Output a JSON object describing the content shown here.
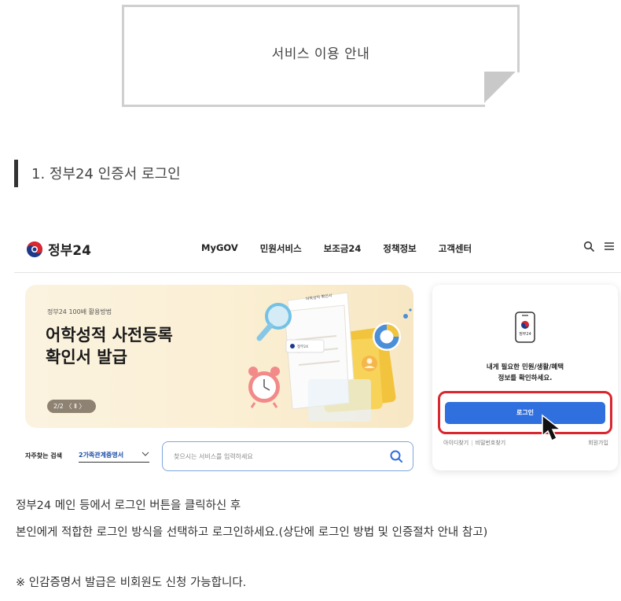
{
  "notice": {
    "title": "서비스 이용 안내"
  },
  "section": {
    "title": "1. 정부24 인증서 로그인"
  },
  "gov24": {
    "logo_text": "정부24",
    "nav": [
      "MyGOV",
      "민원서비스",
      "보조금24",
      "정책정보",
      "고객센터"
    ],
    "icons": {
      "search": "search-icon",
      "menu": "hamburger-menu-icon"
    },
    "banner": {
      "sub": "정부24 100배 활용방법",
      "title_line1": "어학성적 사전등록",
      "title_line2": "확인서 발급",
      "pager": "2/2 〈 Ⅱ 〉",
      "doc_label": "어학성적 확인서",
      "stamp_label": "정부24"
    },
    "quick_search": {
      "label": "자주찾는 검색",
      "selected": "2가족관계증명서"
    },
    "search": {
      "placeholder": "찾으시는 서비스를 입력하세요"
    },
    "login_card": {
      "phone_label": "정부24",
      "message_line1": "내게 필요한 민원/생활/혜택",
      "message_line2": "정보를 확인하세요.",
      "login_button": "로그인",
      "find_id": "아이디찾기",
      "find_pw": "비밀번호찾기",
      "join": "회원가입"
    },
    "colors": {
      "accent": "#2f6fde",
      "highlight": "#d9262f",
      "banner_bg": "#fbf0d6"
    }
  },
  "body": {
    "line1": "정부24 메인 등에서 로그인 버튼을 클릭하신 후",
    "line2": "본인에게 적합한 로그인 방식을 선택하고 로그인하세요.(상단에 로그인 방법 및 인증절차 안내 참고)",
    "note": "※ 인감증명서 발급은 비회원도 신청 가능합니다."
  }
}
